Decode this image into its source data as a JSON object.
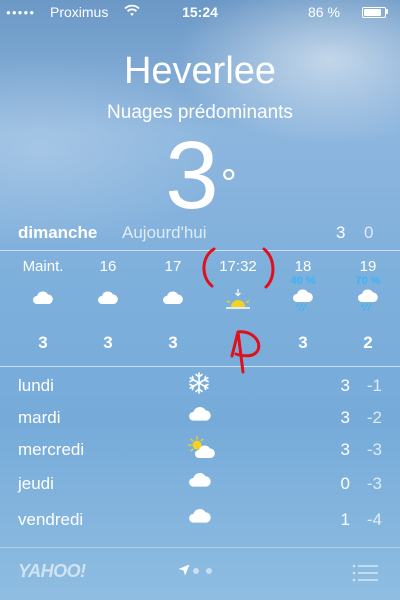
{
  "status_bar": {
    "signal": "●●●●●",
    "carrier": "Proximus",
    "time": "15:24",
    "battery": "86 %",
    "battery_level": 0.86
  },
  "header": {
    "city": "Heverlee",
    "condition": "Nuages prédominants",
    "temperature": "3",
    "degree": "°"
  },
  "today": {
    "day": "dimanche",
    "label": "Aujourd'hui",
    "high": "3",
    "low": "0"
  },
  "hourly": [
    {
      "time": "Maint.",
      "precip": "",
      "icon": "cloud-icon",
      "temp": "3"
    },
    {
      "time": "16",
      "precip": "",
      "icon": "cloud-icon",
      "temp": "3"
    },
    {
      "time": "17",
      "precip": "",
      "icon": "cloud-icon",
      "temp": "3"
    },
    {
      "time": "17:32",
      "precip": "",
      "icon": "sunset-icon",
      "temp": ""
    },
    {
      "time": "18",
      "precip": "40 %",
      "icon": "rain-cloud-icon",
      "temp": "3"
    },
    {
      "time": "19",
      "precip": "70 %",
      "icon": "rain-cloud-icon",
      "temp": "2"
    }
  ],
  "daily": [
    {
      "day": "lundi",
      "icon": "snowflake-icon",
      "high": "3",
      "low": "-1"
    },
    {
      "day": "mardi",
      "icon": "cloud-icon",
      "high": "3",
      "low": "-2"
    },
    {
      "day": "mercredi",
      "icon": "partly-sunny-icon",
      "high": "3",
      "low": "-3"
    },
    {
      "day": "jeudi",
      "icon": "cloud-icon",
      "high": "0",
      "low": "-3"
    },
    {
      "day": "vendredi",
      "icon": "cloud-icon",
      "high": "1",
      "low": "-4"
    }
  ],
  "footer": {
    "brand": "YAHOO!",
    "page_count": 2
  },
  "colors": {
    "precip": "#3cb3f4",
    "annotation": "#e0101a",
    "sun": "#f4d21f"
  }
}
